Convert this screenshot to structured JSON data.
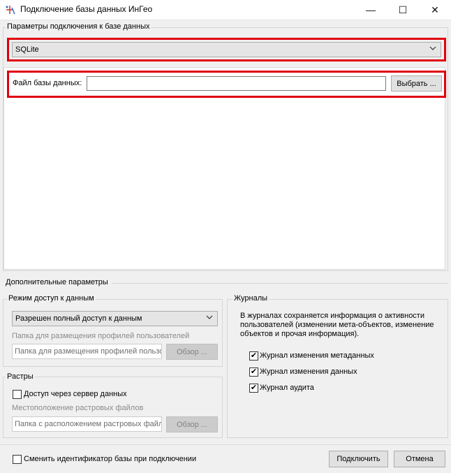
{
  "window": {
    "title": "Подключение базы данных ИнГео",
    "minimize_glyph": "—",
    "maximize_glyph": "☐",
    "close_glyph": "✕"
  },
  "connection": {
    "group_label": "Параметры подключения к базе данных",
    "provider_value": "SQLite",
    "file_label": "Файл базы данных:",
    "file_value": "",
    "browse_button": "Выбрать ..."
  },
  "extra": {
    "section_label": "Дополнительные параметры",
    "access": {
      "group_label": "Режим доступ к данным",
      "mode_value": "Разрешен полный доступ к данным",
      "profiles_label": "Папка для размещения профилей пользователей",
      "profiles_placeholder": "Папка для размещения профилей пользователей",
      "browse_button": "Обзор ..."
    },
    "rasters": {
      "group_label": "Растры",
      "server_access_label": "Доступ через сервер данных",
      "server_access_checked": false,
      "location_label": "Местоположение растровых файлов",
      "location_placeholder": "Папка с расположением растровых файлов",
      "browse_button": "Обзор ..."
    },
    "journals": {
      "group_label": "Журналы",
      "description": "В журналах сохраняется информация о активности пользователей (изменении мета-объектов, изменение объектов и прочая информация).",
      "items": [
        {
          "label": "Журнал изменения метаданных",
          "checked": true
        },
        {
          "label": "Журнал изменения данных",
          "checked": true
        },
        {
          "label": "Журнал аудита",
          "checked": true
        }
      ]
    }
  },
  "footer": {
    "change_id_label": "Сменить идентификатор базы при подключении",
    "change_id_checked": false,
    "connect_button": "Подключить",
    "cancel_button": "Отмена"
  },
  "colors": {
    "highlight": "#e0000c",
    "dialog_bg": "#f0f0f0"
  },
  "icons": {
    "app": "ingeo-app-icon",
    "dropdown": "chevron-down-icon",
    "check": "checkmark-icon"
  }
}
